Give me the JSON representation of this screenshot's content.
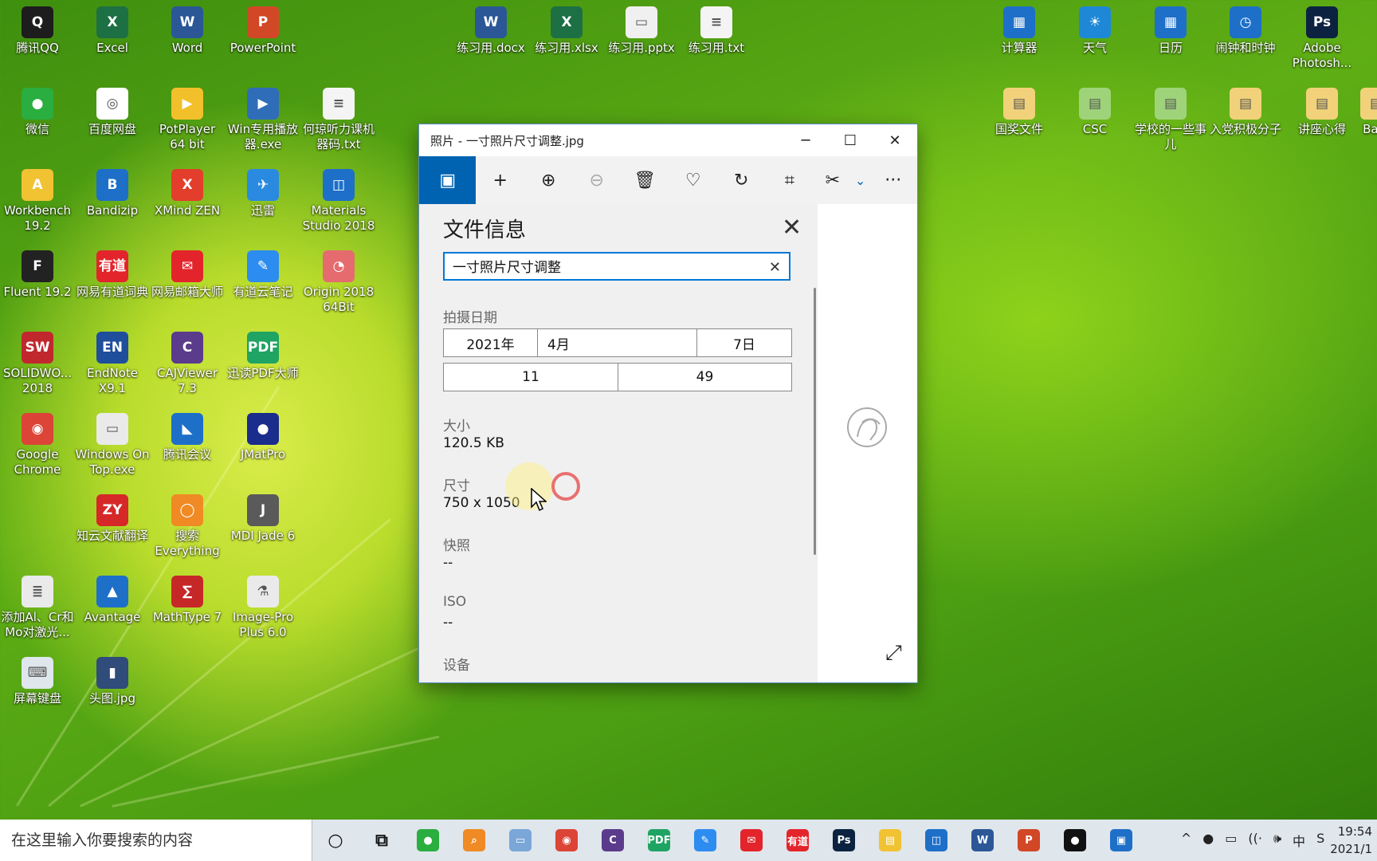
{
  "desktop": {
    "icons": [
      {
        "label": "腾讯QQ",
        "glyph": "Q",
        "color": "#1d1d1d"
      },
      {
        "label": "Excel",
        "glyph": "X",
        "color": "#1d7044"
      },
      {
        "label": "Word",
        "glyph": "W",
        "color": "#2b5797"
      },
      {
        "label": "PowerPoint",
        "glyph": "P",
        "color": "#d24726"
      },
      {
        "label": "练习用.docx",
        "glyph": "W",
        "color": "#2b5797"
      },
      {
        "label": "练习用.xlsx",
        "glyph": "X",
        "color": "#1d7044"
      },
      {
        "label": "练习用.pptx",
        "glyph": "▭",
        "color": "#f0f0f0"
      },
      {
        "label": "练习用.txt",
        "glyph": "≡",
        "color": "#f4f4f4"
      },
      {
        "label": "计算器",
        "glyph": "▦",
        "color": "#1e6fc8"
      },
      {
        "label": "天气",
        "glyph": "☀",
        "color": "#1e88d6"
      },
      {
        "label": "日历",
        "glyph": "▦",
        "color": "#1e6fc8"
      },
      {
        "label": "闹钟和时钟",
        "glyph": "◷",
        "color": "#1e6fc8"
      },
      {
        "label": "Adobe Photosh...",
        "glyph": "Ps",
        "color": "#0b2340"
      },
      {
        "label": "微信",
        "glyph": "●",
        "color": "#2aae3f"
      },
      {
        "label": "百度网盘",
        "glyph": "◎",
        "color": "#ffffff"
      },
      {
        "label": "PotPlayer 64 bit",
        "glyph": "▶",
        "color": "#f2c02a"
      },
      {
        "label": "Win专用播放器.exe",
        "glyph": "▶",
        "color": "#2f6db8"
      },
      {
        "label": "何琼听力课机器码.txt",
        "glyph": "≡",
        "color": "#f4f4f4"
      },
      {
        "label": "国奖文件",
        "glyph": "▤",
        "color": "#f1d27a"
      },
      {
        "label": "CSC",
        "glyph": "▤",
        "color": "#9fd37a"
      },
      {
        "label": "学校的一些事儿",
        "glyph": "▤",
        "color": "#9fd37a"
      },
      {
        "label": "入党积极分子",
        "glyph": "▤",
        "color": "#f1d27a"
      },
      {
        "label": "讲座心得",
        "glyph": "▤",
        "color": "#f1d27a"
      },
      {
        "label": "Workbench 19.2",
        "glyph": "A",
        "color": "#f1c232"
      },
      {
        "label": "Bandizip",
        "glyph": "B",
        "color": "#1e6fc8"
      },
      {
        "label": "XMind ZEN",
        "glyph": "X",
        "color": "#e33d2b"
      },
      {
        "label": "迅雷",
        "glyph": "✈",
        "color": "#2a8ae0"
      },
      {
        "label": "Materials Studio 2018",
        "glyph": "◫",
        "color": "#1e6fc8"
      },
      {
        "label": "Fluent 19.2",
        "glyph": "F",
        "color": "#222"
      },
      {
        "label": "网易有道词典",
        "glyph": "有道",
        "color": "#e3242b"
      },
      {
        "label": "网易邮箱大师",
        "glyph": "✉",
        "color": "#e3242b"
      },
      {
        "label": "有道云笔记",
        "glyph": "✎",
        "color": "#2d8cf0"
      },
      {
        "label": "Origin 2018 64Bit",
        "glyph": "◔",
        "color": "#e56b6f"
      },
      {
        "label": "SOLIDWO... 2018",
        "glyph": "SW",
        "color": "#c0282e"
      },
      {
        "label": "EndNote X9.1",
        "glyph": "EN",
        "color": "#1f4e9c"
      },
      {
        "label": "CAJViewer 7.3",
        "glyph": "C",
        "color": "#5b3b8c"
      },
      {
        "label": "迅读PDF大师",
        "glyph": "PDF",
        "color": "#1fa463"
      },
      {
        "label": "Google Chrome",
        "glyph": "◉",
        "color": "#db4437"
      },
      {
        "label": "Windows On Top.exe",
        "glyph": "▭",
        "color": "#eaeaea"
      },
      {
        "label": "腾讯会议",
        "glyph": "◣",
        "color": "#1e6fc8"
      },
      {
        "label": "JMatPro",
        "glyph": "●",
        "color": "#1a2c8c"
      },
      {
        "label": "知云文献翻译",
        "glyph": "ZY",
        "color": "#d62828"
      },
      {
        "label": "搜索 Everything",
        "glyph": "◯",
        "color": "#f08a24"
      },
      {
        "label": "MDI Jade 6",
        "glyph": "J",
        "color": "#5a5a5a"
      },
      {
        "label": "添加Al、Cr和Mo对激光...",
        "glyph": "≣",
        "color": "#eaeaea"
      },
      {
        "label": "Avantage",
        "glyph": "▲",
        "color": "#1e6fc8"
      },
      {
        "label": "MathType 7",
        "glyph": "∑",
        "color": "#c62828"
      },
      {
        "label": "Image-Pro Plus 6.0",
        "glyph": "⚗",
        "color": "#eaeaea"
      },
      {
        "label": "屏幕键盘",
        "glyph": "⌨",
        "color": "#dfe6ec"
      },
      {
        "label": "头图.jpg",
        "glyph": "▮",
        "color": "#2f4c7a"
      },
      {
        "label": "Ba...",
        "glyph": "▤",
        "color": "#f1d27a"
      }
    ]
  },
  "window": {
    "title": "照片 - 一寸照片尺寸调整.jpg",
    "minimize": "─",
    "maximize": "☐",
    "close": "✕",
    "toolbar": [
      {
        "name": "image-icon",
        "glyph": "▣"
      },
      {
        "name": "add-icon",
        "glyph": "+"
      },
      {
        "name": "zoom-in-icon",
        "glyph": "⊕"
      },
      {
        "name": "zoom-out-icon",
        "glyph": "⊖"
      },
      {
        "name": "delete-icon",
        "glyph": "🗑"
      },
      {
        "name": "favorite-icon",
        "glyph": "♡"
      },
      {
        "name": "rotate-icon",
        "glyph": "↻"
      },
      {
        "name": "crop-icon",
        "glyph": "⌗"
      },
      {
        "name": "edit-icon",
        "glyph": "✂"
      },
      {
        "name": "chevron-down-icon",
        "glyph": "⌄"
      },
      {
        "name": "more-icon",
        "glyph": "···"
      }
    ],
    "info": {
      "heading": "文件信息",
      "close_glyph": "✕",
      "filename": "一寸照片尺寸调整",
      "clear_glyph": "✕",
      "date_label": "拍摄日期",
      "year": "2021年",
      "month": "4月",
      "day": "7日",
      "hour": "11",
      "minute": "49",
      "size_label": "大小",
      "size_value": "120.5 KB",
      "dim_label": "尺寸",
      "dim_value": "750 x 1050",
      "snapshot_label": "快照",
      "snapshot_value": "--",
      "iso_label": "ISO",
      "iso_value": "--",
      "device_label": "设备"
    },
    "expand_glyph": "⤢"
  },
  "taskbar": {
    "search_placeholder": "在这里输入你要搜索的内容",
    "apps": [
      {
        "name": "cortana-icon",
        "glyph": "○",
        "color": "transparent"
      },
      {
        "name": "task-view-icon",
        "glyph": "⧉",
        "color": "transparent"
      },
      {
        "name": "wechat-icon",
        "glyph": "●",
        "color": "#2aae3f"
      },
      {
        "name": "everything-icon",
        "glyph": "⌕",
        "color": "#f08a24"
      },
      {
        "name": "windows-on-top-icon",
        "glyph": "▭",
        "color": "#7aa7d8"
      },
      {
        "name": "chrome-icon",
        "glyph": "◉",
        "color": "#db4437"
      },
      {
        "name": "cajviewer-icon",
        "glyph": "C",
        "color": "#5b3b8c"
      },
      {
        "name": "pdf-icon",
        "glyph": "PDF",
        "color": "#1fa463"
      },
      {
        "name": "youdao-note-icon",
        "glyph": "✎",
        "color": "#2d8cf0"
      },
      {
        "name": "mail-master-icon",
        "glyph": "✉",
        "color": "#e3242b"
      },
      {
        "name": "youdao-dict-icon",
        "glyph": "有道",
        "color": "#e3242b"
      },
      {
        "name": "photoshop-icon",
        "glyph": "Ps",
        "color": "#0b2340"
      },
      {
        "name": "file-explorer-icon",
        "glyph": "▤",
        "color": "#f1c232"
      },
      {
        "name": "materials-studio-icon",
        "glyph": "◫",
        "color": "#1e6fc8"
      },
      {
        "name": "word-icon",
        "glyph": "W",
        "color": "#2b5797"
      },
      {
        "name": "powerpoint-icon",
        "glyph": "P",
        "color": "#d24726"
      },
      {
        "name": "recorder-icon",
        "glyph": "●",
        "color": "#111"
      },
      {
        "name": "photos-icon",
        "glyph": "▣",
        "color": "#1e6fc8"
      }
    ],
    "tray": [
      "^",
      "●",
      "▭",
      "((·",
      "🕪",
      "中",
      "S"
    ],
    "time": "19:54",
    "date": "2021/1"
  }
}
